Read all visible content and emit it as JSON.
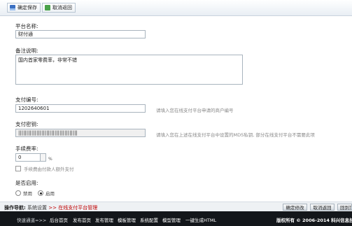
{
  "toolbar": {
    "save_label": "确定保存",
    "cancel_label": "取消返回"
  },
  "form": {
    "platform_name": {
      "label": "平台名称:",
      "value": "财付通"
    },
    "remarks": {
      "label": "备注说明:",
      "value": "国内首家零费率，非常不错"
    },
    "pay_account": {
      "label": "支付编号:",
      "value": "1202640601",
      "hint": "请填入您在线支付平台申请的商户编号"
    },
    "pay_key": {
      "label": "支付密钥:",
      "value": "||||||||||||||||||||||||||||||||||||",
      "hint": "请填入您在上述在线支付平台中设置的MD5私钥, 部分在线支付平台不需要此项"
    },
    "fee_rate": {
      "label": "手续费率:",
      "value": "0",
      "unit": "%",
      "checkbox_label": "手续费由付款人额外支付"
    },
    "enabled": {
      "label": "是否启用:",
      "options": [
        "禁用",
        "启用"
      ],
      "selected": "启用"
    }
  },
  "bottom_bar": {
    "nav_label": "操作导航:",
    "crumb_parent": "系统设置",
    "sep": ">>",
    "crumb_current": "在线支付平台管理",
    "buttons": [
      "确定修改",
      "取消返回",
      "回到顶部"
    ]
  },
  "footer": {
    "quick_label": "快速通道=>>",
    "links": [
      "后台首页",
      "发布首页",
      "发布管理",
      "模板管理",
      "系统配置",
      "模型管理",
      "一键生成HTML"
    ],
    "copyright": "版权所有 © 2006-2014 科兴信息技"
  }
}
